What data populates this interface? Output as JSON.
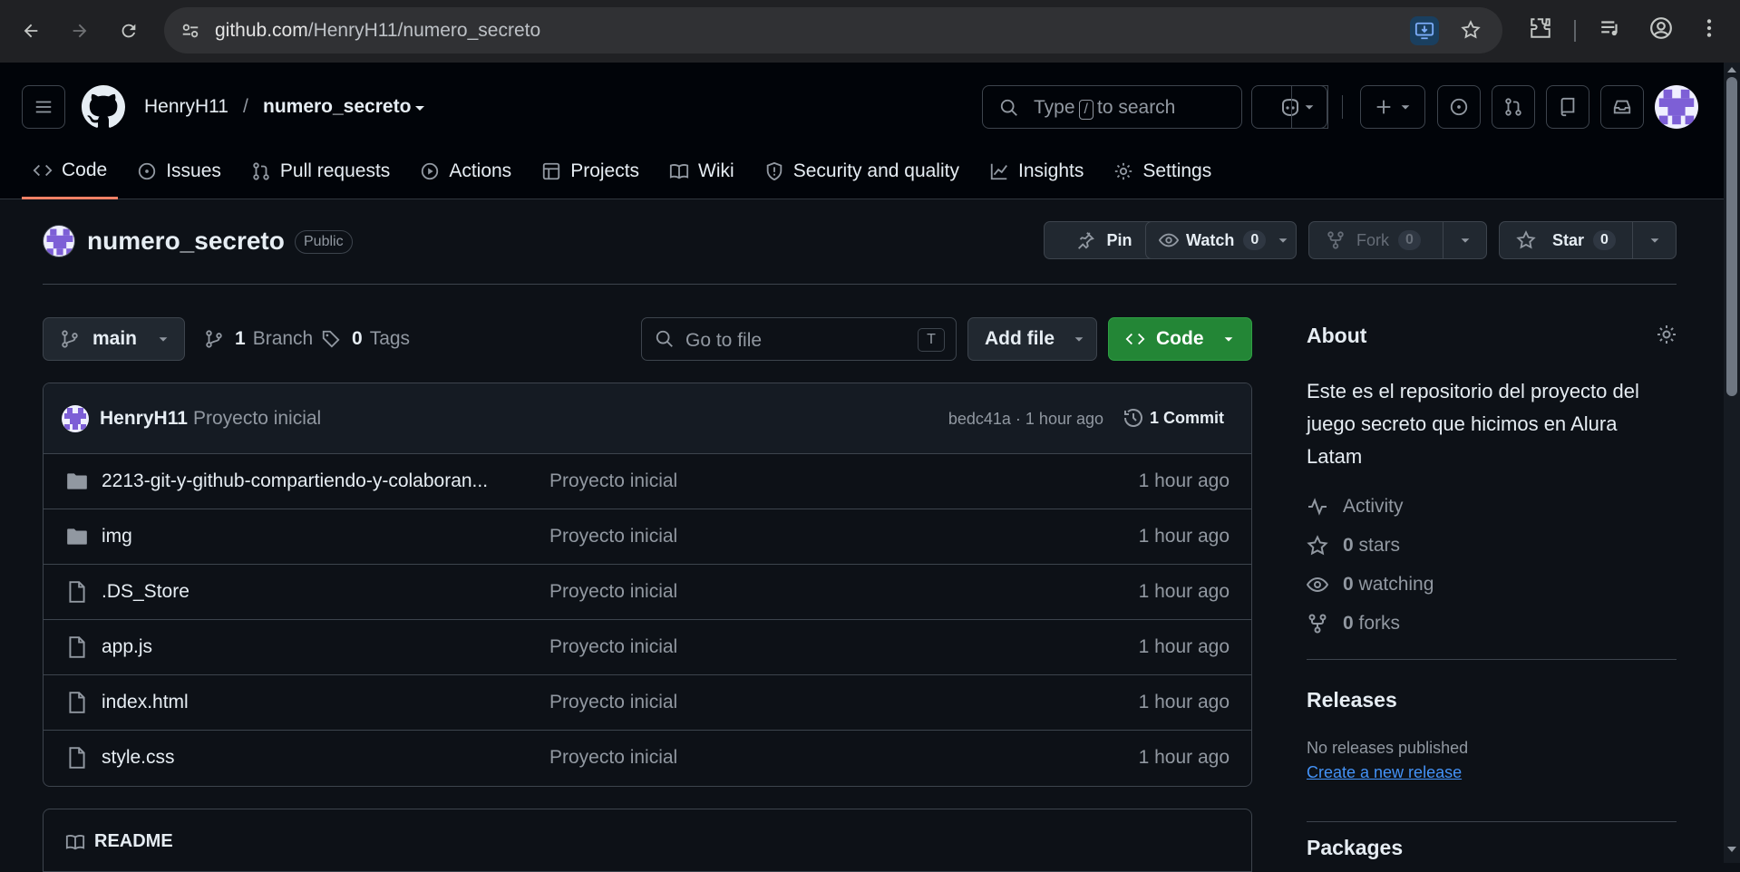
{
  "browser": {
    "url_host": "github.com",
    "url_path": "/HenryH11/numero_secreto"
  },
  "header": {
    "owner": "HenryH11",
    "separator": "/",
    "repo": "numero_secreto",
    "search_type": "Type",
    "search_key": "/",
    "search_rest": "to search"
  },
  "tabs": [
    {
      "label": "Code",
      "icon": "code-icon"
    },
    {
      "label": "Issues",
      "icon": "issue-icon"
    },
    {
      "label": "Pull requests",
      "icon": "pull-request-icon"
    },
    {
      "label": "Actions",
      "icon": "play-icon"
    },
    {
      "label": "Projects",
      "icon": "table-icon"
    },
    {
      "label": "Wiki",
      "icon": "book-icon"
    },
    {
      "label": "Security and quality",
      "icon": "shield-icon"
    },
    {
      "label": "Insights",
      "icon": "graph-icon"
    },
    {
      "label": "Settings",
      "icon": "gear-icon"
    }
  ],
  "repo": {
    "name": "numero_secreto",
    "visibility": "Public",
    "pin_label": "Pin",
    "watch_label": "Watch",
    "watch_count": "0",
    "fork_label": "Fork",
    "fork_count": "0",
    "star_label": "Star",
    "star_count": "0"
  },
  "toolbar": {
    "branch": "main",
    "branch_count": "1",
    "branch_label": "Branch",
    "tag_count": "0",
    "tag_label": "Tags",
    "goto_placeholder": "Go to file",
    "goto_key": "T",
    "add_file": "Add file",
    "code": "Code"
  },
  "commit": {
    "author": "HenryH11",
    "message": "Proyecto inicial",
    "hash_time": "bedc41a · 1 hour ago",
    "commits": "1 Commit"
  },
  "files": [
    {
      "name": "2213-git-y-github-compartiendo-y-colaboran...",
      "type": "folder",
      "message": "Proyecto inicial",
      "time": "1 hour ago"
    },
    {
      "name": "img",
      "type": "folder",
      "message": "Proyecto inicial",
      "time": "1 hour ago"
    },
    {
      "name": ".DS_Store",
      "type": "file",
      "message": "Proyecto inicial",
      "time": "1 hour ago"
    },
    {
      "name": "app.js",
      "type": "file",
      "message": "Proyecto inicial",
      "time": "1 hour ago"
    },
    {
      "name": "index.html",
      "type": "file",
      "message": "Proyecto inicial",
      "time": "1 hour ago"
    },
    {
      "name": "style.css",
      "type": "file",
      "message": "Proyecto inicial",
      "time": "1 hour ago"
    }
  ],
  "readme": {
    "label": "README"
  },
  "about": {
    "title": "About",
    "description": "Este es el repositorio del proyecto del juego secreto que hicimos en Alura Latam",
    "activity": "Activity",
    "stars_count": "0",
    "stars_label": "stars",
    "watching_count": "0",
    "watching_label": "watching",
    "forks_count": "0",
    "forks_label": "forks"
  },
  "releases": {
    "title": "Releases",
    "none": "No releases published",
    "create_link": "Create a new release"
  },
  "packages": {
    "title": "Packages"
  },
  "colors": {
    "accent_green": "#238636",
    "tab_underline": "#f78166",
    "link": "#4493f8"
  }
}
